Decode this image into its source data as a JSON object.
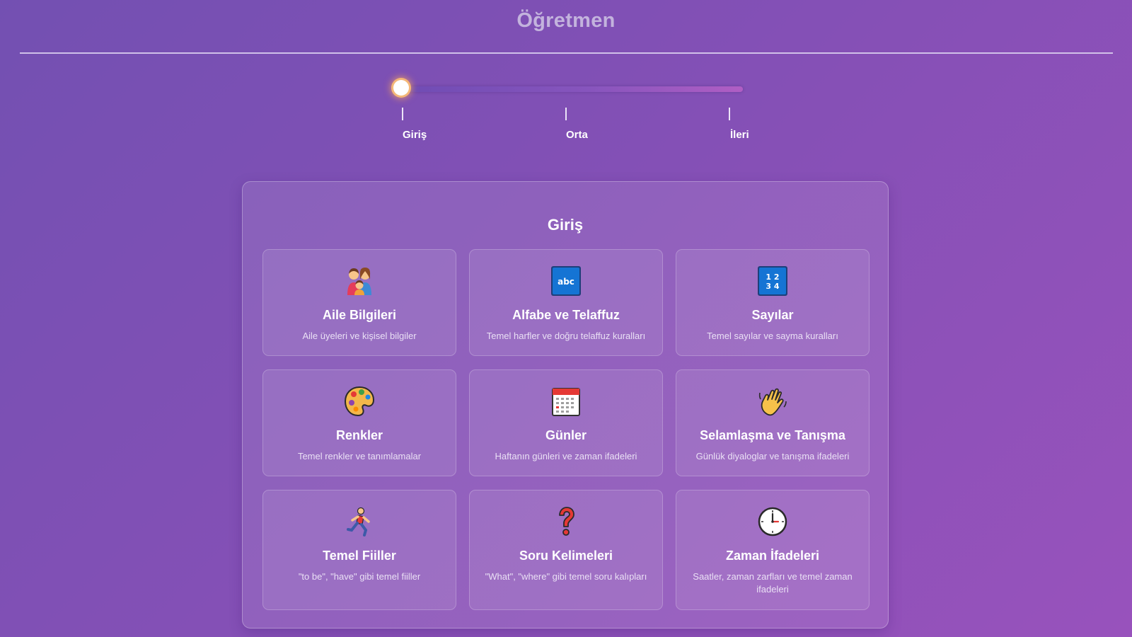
{
  "header": {
    "title": "Öğretmen"
  },
  "level_slider": {
    "levels": [
      "Giriş",
      "Orta",
      "İleri"
    ],
    "selected_index": 0,
    "position": 0
  },
  "content": {
    "heading": "Giriş",
    "topics": [
      {
        "icon": "family-icon",
        "title": "Aile Bilgileri",
        "description": "Aile üyeleri ve kişisel bilgiler"
      },
      {
        "icon": "abc-icon",
        "title": "Alfabe ve Telaffuz",
        "description": "Temel harfler ve doğru telaffuz kuralları"
      },
      {
        "icon": "numbers-icon",
        "title": "Sayılar",
        "description": "Temel sayılar ve sayma kuralları"
      },
      {
        "icon": "palette-icon",
        "title": "Renkler",
        "description": "Temel renkler ve tanımlamalar"
      },
      {
        "icon": "calendar-icon",
        "title": "Günler",
        "description": "Haftanın günleri ve zaman ifadeleri"
      },
      {
        "icon": "waving-hand-icon",
        "title": "Selamlaşma ve Tanışma",
        "description": "Günlük diyaloglar ve tanışma ifadeleri"
      },
      {
        "icon": "running-person-icon",
        "title": "Temel Fiiller",
        "description": "\"to be\", \"have\" gibi temel fiiller"
      },
      {
        "icon": "question-mark-icon",
        "title": "Soru Kelimeleri",
        "description": "\"What\", \"where\" gibi temel soru kalıpları"
      },
      {
        "icon": "clock-icon",
        "title": "Zaman İfadeleri",
        "description": "Saatler, zaman zarfları ve temel zaman ifadeleri"
      }
    ]
  },
  "colors": {
    "background_start": "#7350b2",
    "background_end": "#9852bc",
    "title_color": "#c3b3dd",
    "slider_glow": "#f4b778"
  }
}
